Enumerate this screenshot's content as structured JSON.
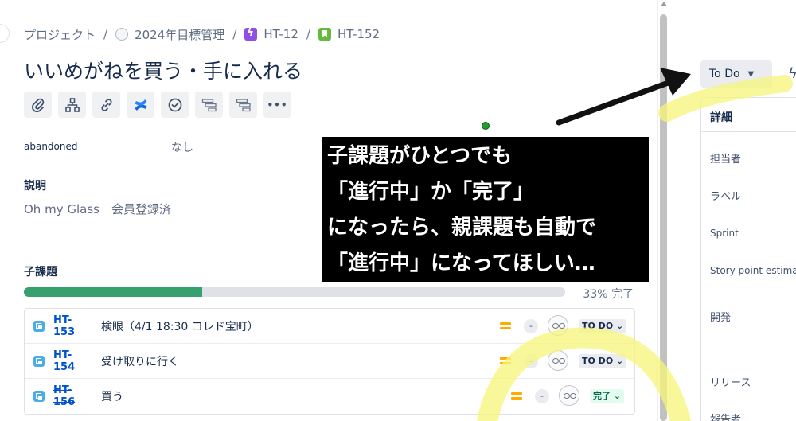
{
  "breadcrumb": {
    "project": "プロジェクト",
    "separator": "/",
    "board": "2024年目標管理",
    "epic": "HT-12",
    "story": "HT-152"
  },
  "issue": {
    "title": "いいめがねを買う・手に入れる"
  },
  "toolbar": {
    "buttons": [
      "attach-icon",
      "hierarchy-icon",
      "link-icon",
      "confluence-icon",
      "checklist-icon",
      "gantt-icon",
      "gantt-icon",
      "more-icon"
    ],
    "more_label": "•••"
  },
  "fields": {
    "abandoned_label": "abandoned",
    "abandoned_value": "なし",
    "description_label": "説明",
    "description_value": "Oh my Glass　会員登録済"
  },
  "subtasks": {
    "label": "子課題",
    "progress_percent": 33,
    "progress_text": "33% 完了",
    "items": [
      {
        "key": "HT-153",
        "summary": "検眼（4/1 18:30 コレド宝町）",
        "estimate": "-",
        "status": "TO DO",
        "done": false
      },
      {
        "key": "HT-154",
        "summary": "受け取りに行く",
        "estimate": "-",
        "status": "TO DO",
        "done": false
      },
      {
        "key": "HT-156",
        "summary": "買う",
        "estimate": "-",
        "status": "完了",
        "done": true
      }
    ]
  },
  "right_panel": {
    "status_button": "To Do",
    "details_heading": "詳細",
    "assignee": "担当者",
    "labels": "ラベル",
    "sprint": "Sprint",
    "story_points": "Story point estimate",
    "development": "開発",
    "release": "リリース",
    "reporter": "報告者"
  },
  "annotation": {
    "lines": [
      "子課題がひとつでも",
      "「進行中」か「完了」",
      "になったら、親課題も自動で",
      "「進行中」になってほしい…"
    ]
  },
  "colors": {
    "progress_fill": "#36a16e",
    "link": "#0052cc",
    "highlight": "#f5f57a",
    "done_badge": "#e3fcef"
  }
}
